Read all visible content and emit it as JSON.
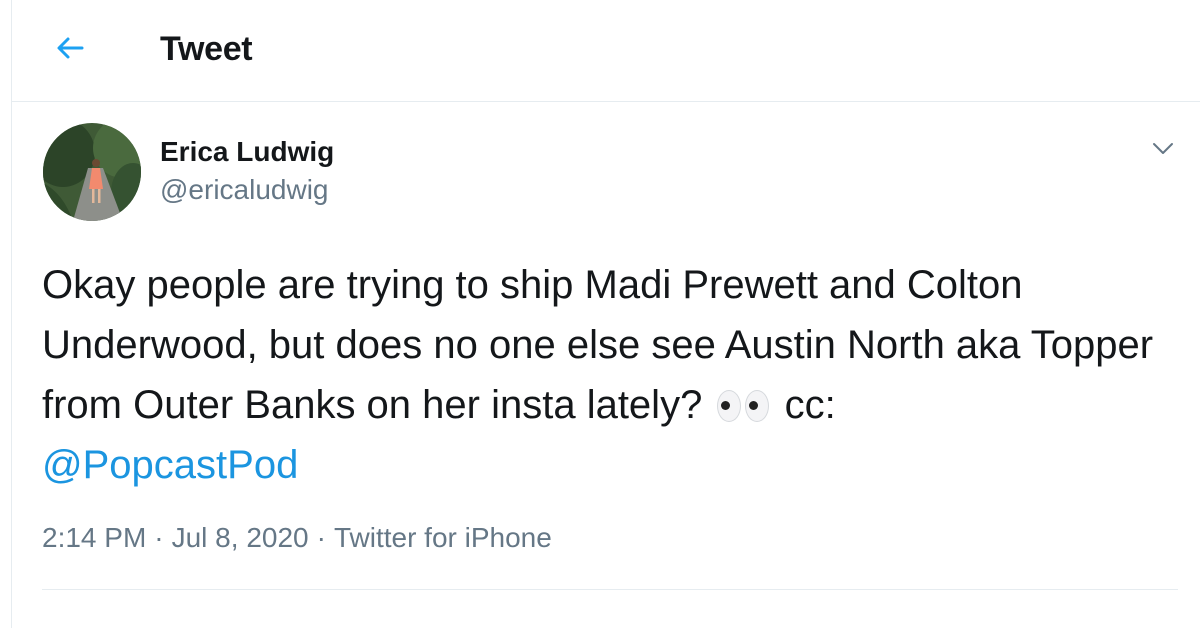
{
  "header": {
    "back_icon": "arrow-left-icon",
    "title": "Tweet"
  },
  "author": {
    "name": "Erica Ludwig",
    "handle": "@ericaludwig",
    "avatar_icon": "profile-photo"
  },
  "menu_icon": "chevron-down-icon",
  "tweet": {
    "text_before_emoji": "Okay people are trying to ship Madi Prewett and Colton Underwood, but does no one else see Austin North aka Topper from Outer Banks on her insta lately?",
    "emoji_icon": "eyes-emoji",
    "text_after_emoji": "cc:",
    "mention": "@PopcastPod"
  },
  "meta": {
    "time": "2:14 PM",
    "date": "Jul 8, 2020",
    "source": "Twitter for iPhone",
    "separator": "·"
  },
  "colors": {
    "link": "#1b95e0",
    "secondary_text": "#657786",
    "border": "#e6ecf0"
  }
}
